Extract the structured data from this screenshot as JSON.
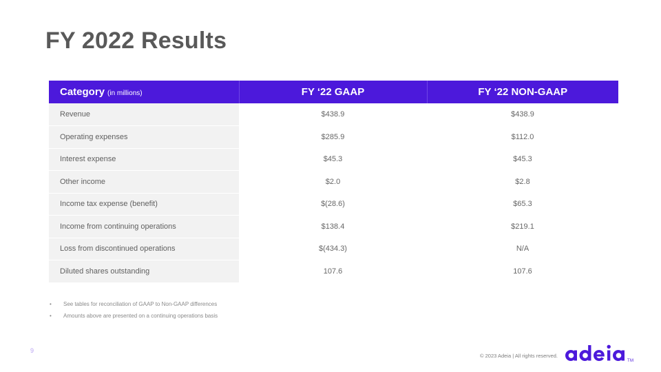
{
  "slide": {
    "title": "FY 2022 Results",
    "page_number": "9",
    "copyright": "© 2023 Adeia | All rights reserved.",
    "accent_color": "#4C19DB",
    "title_color": "#595959",
    "row_bg_color": "#F2F2F2"
  },
  "table": {
    "header": {
      "category_label": "Category",
      "category_unit": "(in millions)",
      "gaap_label": "FY ‘22 GAAP",
      "non_gaap_label": "FY ‘22 NON-GAAP"
    },
    "columns": [
      "Category (in millions)",
      "FY ‘22 GAAP",
      "FY ‘22 NON-GAAP"
    ],
    "rows": [
      {
        "category": "Revenue",
        "gaap": "$438.9",
        "non_gaap": "$438.9"
      },
      {
        "category": "Operating expenses",
        "gaap": "$285.9",
        "non_gaap": "$112.0"
      },
      {
        "category": "Interest expense",
        "gaap": "$45.3",
        "non_gaap": "$45.3"
      },
      {
        "category": "Other income",
        "gaap": "$2.0",
        "non_gaap": "$2.8"
      },
      {
        "category": "Income tax expense (benefit)",
        "gaap": "$(28.6)",
        "non_gaap": "$65.3"
      },
      {
        "category": "Income from continuing operations",
        "gaap": "$138.4",
        "non_gaap": "$219.1"
      },
      {
        "category": "Loss from discontinued operations",
        "gaap": "$(434.3)",
        "non_gaap": "N/A"
      },
      {
        "category": "Diluted shares outstanding",
        "gaap": "107.6",
        "non_gaap": "107.6"
      }
    ]
  },
  "footnotes": {
    "bullet_glyph": "•",
    "items": [
      "See tables for reconciliation of GAAP to Non-GAAP differences",
      "Amounts above are presented on a continuing operations basis"
    ]
  },
  "logo": {
    "wordmark": "adeia",
    "trademark": "TM",
    "color": "#4C19DB"
  }
}
